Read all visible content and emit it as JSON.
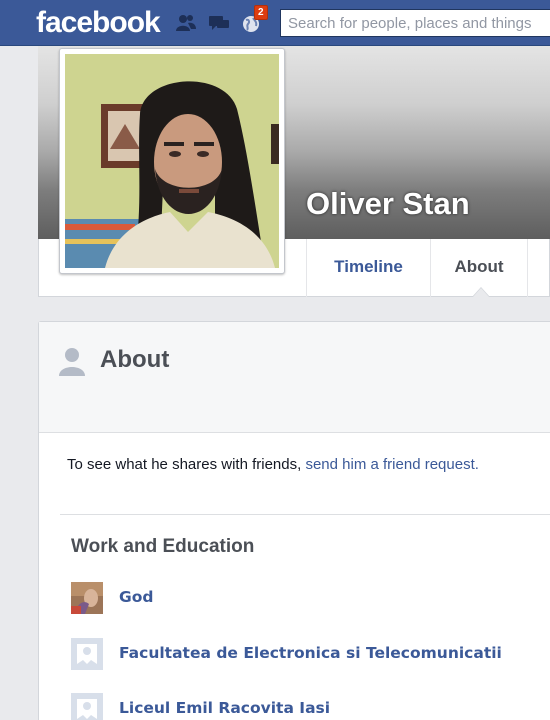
{
  "header": {
    "logo": "facebook",
    "notification_count": "2",
    "search_placeholder": "Search for people, places and things"
  },
  "profile": {
    "name": "Oliver Stan",
    "tabs": [
      "Timeline",
      "About"
    ]
  },
  "about": {
    "title": "About",
    "notice_prefix": "To see what he shares with friends, ",
    "notice_link": "send him a friend request.",
    "work_education": {
      "title": "Work and Education",
      "items": [
        {
          "label": "God"
        },
        {
          "label": "Facultatea de Electronica si Telecomunicatii"
        },
        {
          "label": "Liceul Emil Racovita Iasi"
        }
      ]
    }
  },
  "colors": {
    "brand": "#3b5998",
    "badge": "#dd3c10"
  }
}
